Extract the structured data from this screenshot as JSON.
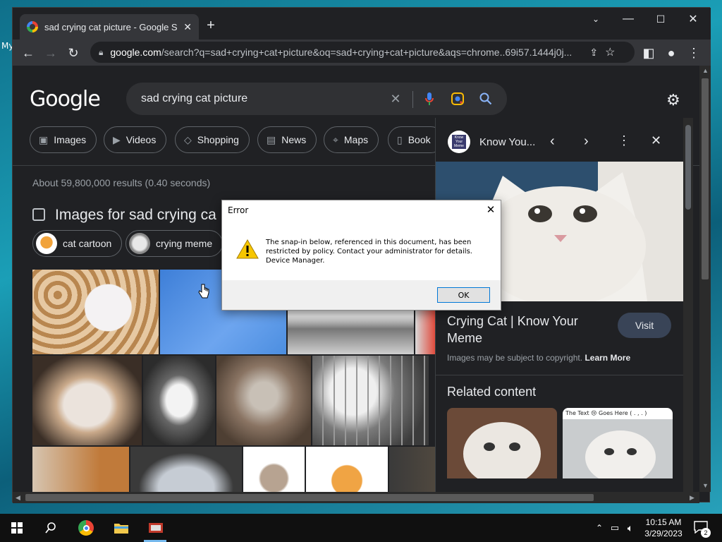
{
  "desktop": {
    "icon_label_fragment": "My"
  },
  "browser": {
    "tab_title": "sad crying cat picture - Google Se",
    "new_tab": "+",
    "url_host": "google.com",
    "url_rest": "/search?q=sad+crying+cat+picture&oq=sad+crying+cat+picture&aqs=chrome..69i57.1444j0j..."
  },
  "google": {
    "logo": "Google",
    "query": "sad crying cat picture",
    "chips": [
      "Images",
      "Videos",
      "Shopping",
      "News",
      "Maps",
      "Book"
    ],
    "result_stats": "About 59,800,000 results (0.40 seconds)",
    "images_heading": "Images for sad crying ca",
    "image_chips": [
      "cat cartoon",
      "crying meme"
    ]
  },
  "knowledge_panel": {
    "source": "Know You...",
    "logo_text": "Know Your Meme",
    "title": "Crying Cat | Know Your Meme",
    "visit_label": "Visit",
    "copyright": "Images may be subject to copyright.",
    "learn_more": "Learn More",
    "related_heading": "Related content",
    "related_2_text": "The Text 😢 Goes Here ( . , . )"
  },
  "dialog": {
    "title": "Error",
    "message": "The snap-in below, referenced in this document, has been restricted by policy. Contact your administrator for details. Device Manager.",
    "ok_label": "OK"
  },
  "taskbar": {
    "time": "10:15 AM",
    "date": "3/29/2023",
    "notification_count": "2"
  },
  "colors": {
    "page_bg": "#202124",
    "chip_border": "#5f6368",
    "visit_bg": "#394457",
    "dialog_accent": "#0078d7"
  }
}
